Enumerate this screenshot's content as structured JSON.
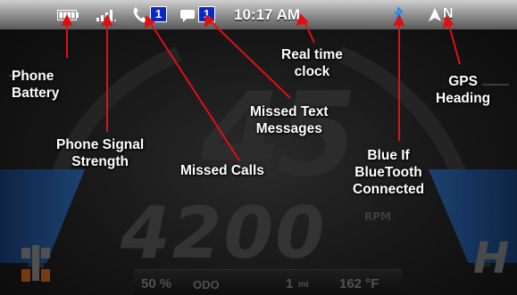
{
  "status_bar": {
    "clock": "10:17 AM",
    "missed_calls_count": "1",
    "missed_texts_count": "1",
    "gps_heading": "N",
    "colors": {
      "bluetooth": "#1e90ff",
      "badge": "#0a27c8"
    }
  },
  "dashboard": {
    "speed": "45",
    "rpm": "4200",
    "rpm_unit": "RPM",
    "gear": "H",
    "fuel_percent": "50 %",
    "odo_label": "ODO",
    "odo_value": "1",
    "odo_unit": "mi",
    "temperature": "162 °F"
  },
  "annotations": {
    "phone_battery": "Phone\nBattery",
    "phone_signal": "Phone Signal\nStrength",
    "missed_calls": "Missed Calls",
    "missed_texts": "Missed Text\nMessages",
    "real_time_clock": "Real time\nclock",
    "bluetooth": "Blue If\nBlueTooth\nConnected",
    "gps_heading": "GPS\nHeading"
  },
  "icons": [
    "battery-icon",
    "signal-bars-icon",
    "phone-icon",
    "message-icon",
    "bluetooth-icon",
    "navigation-arrow-icon",
    "atv-icon"
  ]
}
